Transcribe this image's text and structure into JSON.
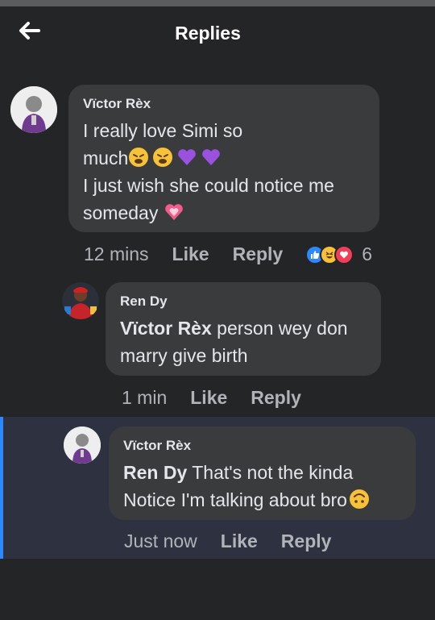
{
  "header": {
    "title": "Replies"
  },
  "comments": [
    {
      "author": "Vïctor Rèx",
      "line1": "I really love Simi so",
      "line2": "much",
      "line3": "I just wish she could notice me",
      "line4": "someday",
      "time": "12 mins",
      "like_label": "Like",
      "reply_label": "Reply",
      "reaction_count": "6"
    },
    {
      "author": "Ren Dy",
      "mention": "Vïctor Rèx",
      "line1": "person wey don",
      "line2": "marry give birth",
      "time": "1 min",
      "like_label": "Like",
      "reply_label": "Reply"
    },
    {
      "author": "Vïctor Rèx",
      "mention": "Ren Dy",
      "line1": "That's not the kinda",
      "line2": "Notice I'm talking about bro",
      "time": "Just now",
      "like_label": "Like",
      "reply_label": "Reply"
    }
  ],
  "colors": {
    "bubble": "#3a3b3c",
    "background": "#242526",
    "highlight": "#2e3240",
    "accent": "#2d88ff"
  }
}
